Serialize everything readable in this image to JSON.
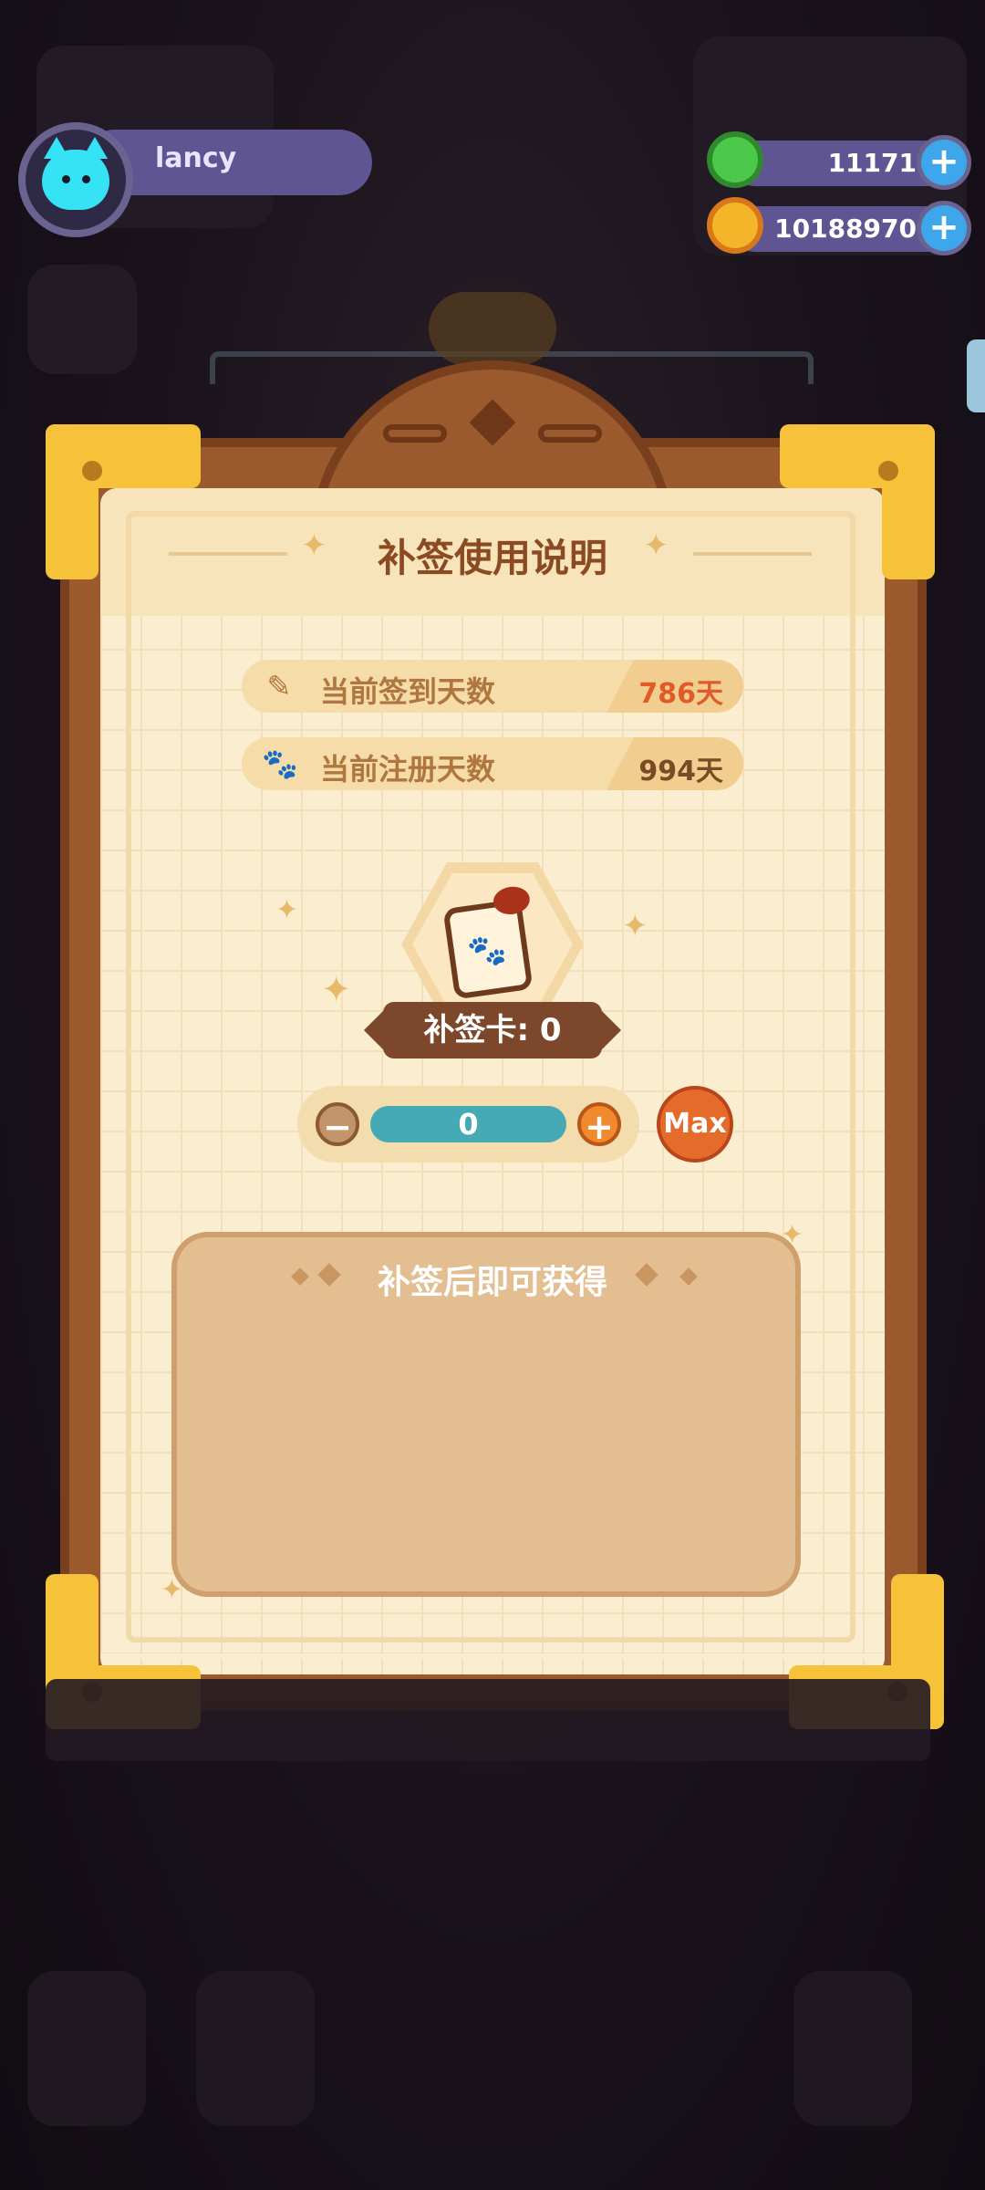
{
  "profile": {
    "username": "lancy"
  },
  "currencies": [
    {
      "name": "green-donut-coin",
      "value": "11171",
      "color": "#4cc94a"
    },
    {
      "name": "gold-planet-coin",
      "value": "10188970",
      "color": "#f5b52a"
    }
  ],
  "dialog": {
    "title": "补签使用说明",
    "stats": [
      {
        "icon": "pencil-icon",
        "label": "当前签到天数",
        "value": "786天",
        "value_color": "#e15a2a"
      },
      {
        "icon": "paw-icon",
        "label": "当前注册天数",
        "value": "994天",
        "value_color": "#7a4a26"
      }
    ],
    "card_count_label": "补签卡: 0",
    "stepper_value": "0",
    "max_label": "Max",
    "rewards_title": "补签后即可获得"
  },
  "colors": {
    "frame": "#9a5a2e",
    "paper": "#fbedcf",
    "gold_corner": "#f5c23a",
    "accent_orange": "#e46b2a",
    "teal": "#45aab3"
  }
}
